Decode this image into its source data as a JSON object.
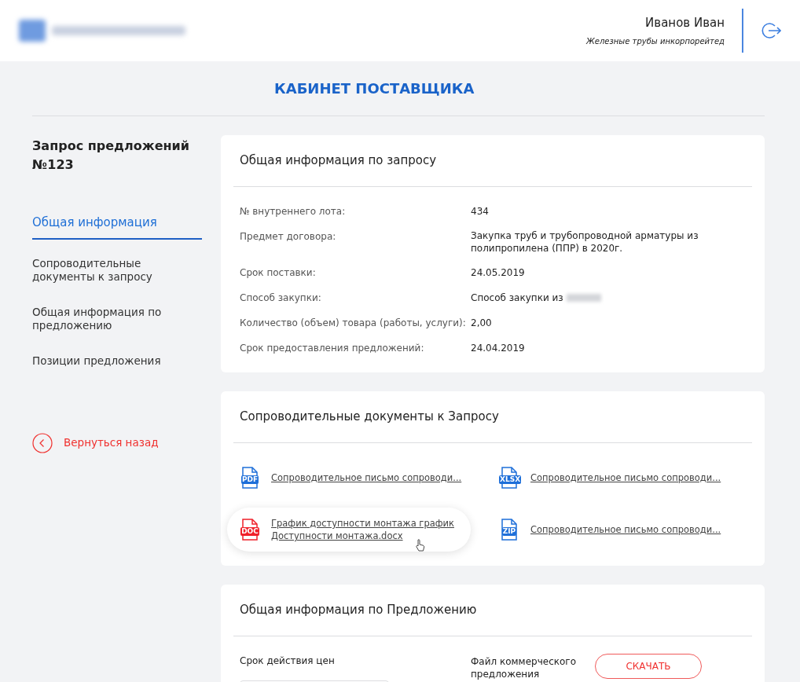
{
  "header": {
    "user_name": "Иванов Иван",
    "company": "Железные трубы инкорпорейтед"
  },
  "page_title": "КАБИНЕТ ПОСТАВЩИКА",
  "sidebar": {
    "title": "Запрос предложений №123",
    "items": [
      {
        "label": "Общая информация",
        "selected": true
      },
      {
        "label": "Сопроводительные документы к запросу",
        "selected": false
      },
      {
        "label": "Общая информация по предложению",
        "selected": false
      },
      {
        "label": "Позиции предложения",
        "selected": false
      }
    ],
    "back_link": "Вернуться назад"
  },
  "request_card": {
    "title": "Общая информация по запросу",
    "fields": [
      {
        "label": "№ внутреннего лота:",
        "value": "434"
      },
      {
        "label": "Предмет договора:",
        "value": "Закупка труб и трубопроводной арматуры из полипропилена (ППР) в 2020г."
      },
      {
        "label": "Срок поставки:",
        "value": "24.05.2019"
      },
      {
        "label": "Способ закупки:",
        "value": "Способ закупки из",
        "redacted": true
      },
      {
        "label": "Количество (объем) товара (работы, услуги):",
        "value": "2,00"
      },
      {
        "label": "Срок предоставления предложений:",
        "value": "24.04.2019"
      }
    ]
  },
  "documents_card": {
    "title": "Сопроводительные документы к Запросу",
    "documents": [
      {
        "kind": "pdf",
        "badge": "PDF",
        "name": "Сопроводительное письмо сопроводи...",
        "highlighted": false
      },
      {
        "kind": "xlsx",
        "badge": "XLSX",
        "name": "Сопроводительное письмо сопроводи...",
        "highlighted": false
      },
      {
        "kind": "doc",
        "badge": "DOC",
        "name": "График доступности монтажа график Доступности монтажа.docx",
        "highlighted": true
      },
      {
        "kind": "zip",
        "badge": "ZIP",
        "name": "Сопроводительное письмо сопроводи...",
        "highlighted": false
      }
    ]
  },
  "offer_card": {
    "title": "Общая информация по Предложению",
    "price_validity_label": "Срок действия цен",
    "file_label": "Файл коммерческого предложения",
    "download_button": "СКАЧАТЬ"
  }
}
